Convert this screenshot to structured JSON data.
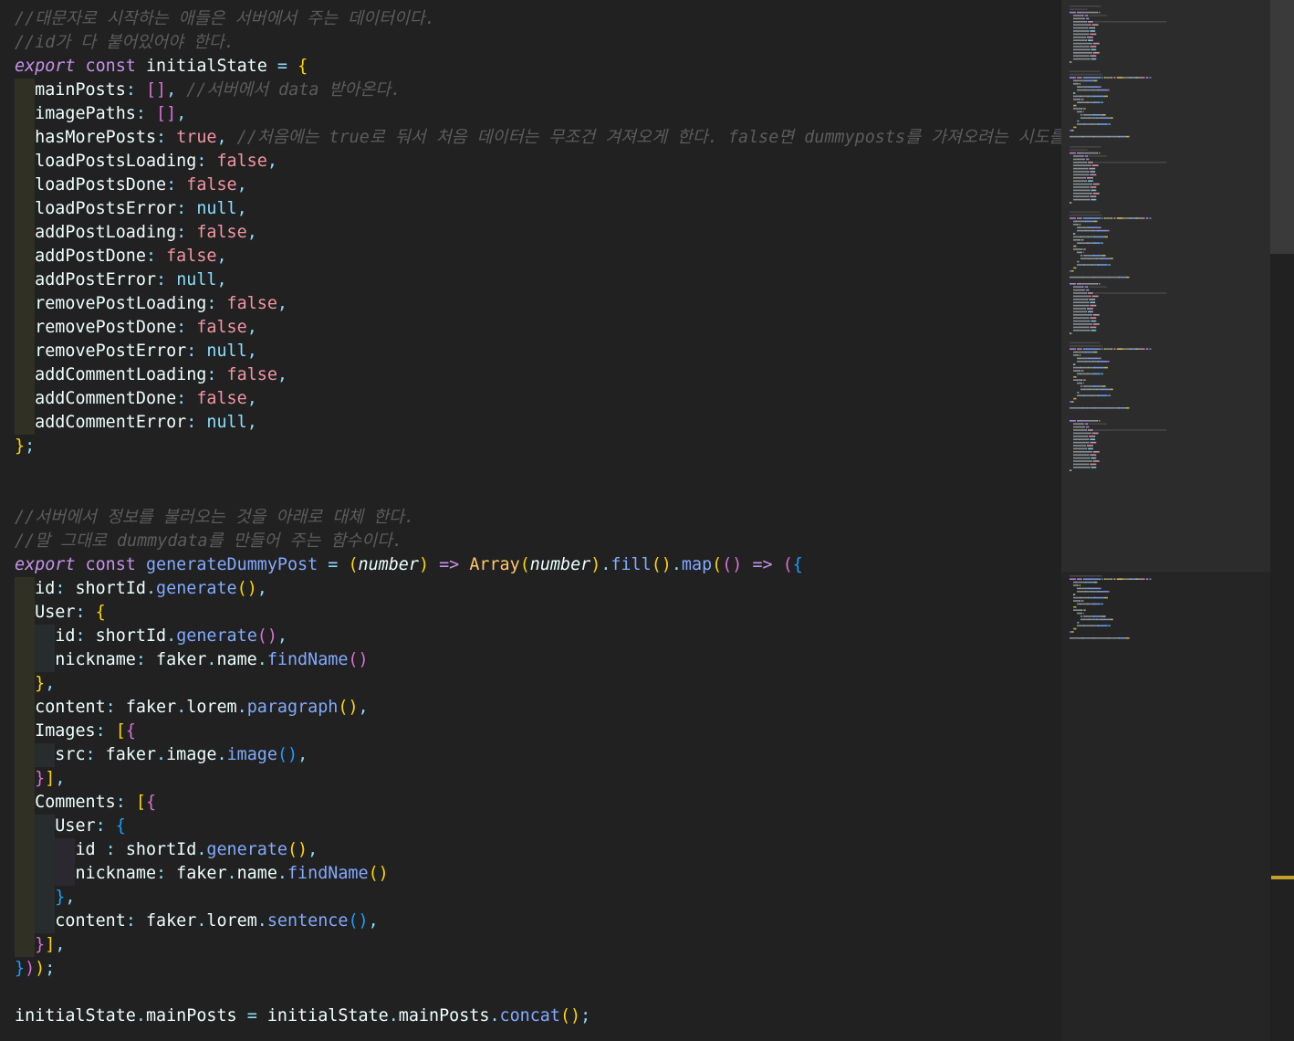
{
  "editor": {
    "language": "javascript",
    "lines": [
      {
        "indent": 0,
        "tokens": [
          [
            "cm",
            "//대문자로 시작하는 애들은 서버에서 주는 데이터이다."
          ]
        ]
      },
      {
        "indent": 0,
        "tokens": [
          [
            "cm",
            "//id가 다 붙어있어야 한다."
          ]
        ]
      },
      {
        "indent": 0,
        "tokens": [
          [
            "kw-i",
            "export"
          ],
          [
            "t",
            " "
          ],
          [
            "kw",
            "const"
          ],
          [
            "t",
            " initialState "
          ],
          [
            "op",
            "="
          ],
          [
            "t",
            " "
          ],
          [
            "p1",
            "{"
          ]
        ]
      },
      {
        "indent": 1,
        "tokens": [
          [
            "prop",
            "mainPosts"
          ],
          [
            "op",
            ":"
          ],
          [
            "t",
            " "
          ],
          [
            "p2",
            "[]"
          ],
          [
            "op",
            ","
          ],
          [
            "t",
            " "
          ],
          [
            "cm",
            "//서버에서 data 받아온다."
          ]
        ]
      },
      {
        "indent": 1,
        "tokens": [
          [
            "prop",
            "imagePaths"
          ],
          [
            "op",
            ":"
          ],
          [
            "t",
            " "
          ],
          [
            "p2",
            "[]"
          ],
          [
            "op",
            ","
          ]
        ]
      },
      {
        "indent": 1,
        "tokens": [
          [
            "prop",
            "hasMorePosts"
          ],
          [
            "op",
            ":"
          ],
          [
            "t",
            " "
          ],
          [
            "bool",
            "true"
          ],
          [
            "op",
            ","
          ],
          [
            "t",
            " "
          ],
          [
            "cm",
            "//처음에는 true로 둬서 처음 데이터는 무조건 겨져오게 한다. false면 dummyposts를 가져오려는 시도를 막는다"
          ]
        ]
      },
      {
        "indent": 1,
        "tokens": [
          [
            "prop",
            "loadPostsLoading"
          ],
          [
            "op",
            ":"
          ],
          [
            "t",
            " "
          ],
          [
            "bool",
            "false"
          ],
          [
            "op",
            ","
          ]
        ]
      },
      {
        "indent": 1,
        "tokens": [
          [
            "prop",
            "loadPostsDone"
          ],
          [
            "op",
            ":"
          ],
          [
            "t",
            " "
          ],
          [
            "bool",
            "false"
          ],
          [
            "op",
            ","
          ]
        ]
      },
      {
        "indent": 1,
        "tokens": [
          [
            "prop",
            "loadPostsError"
          ],
          [
            "op",
            ":"
          ],
          [
            "t",
            " "
          ],
          [
            "nul",
            "null"
          ],
          [
            "op",
            ","
          ]
        ]
      },
      {
        "indent": 1,
        "tokens": [
          [
            "prop",
            "addPostLoading"
          ],
          [
            "op",
            ":"
          ],
          [
            "t",
            " "
          ],
          [
            "bool",
            "false"
          ],
          [
            "op",
            ","
          ]
        ]
      },
      {
        "indent": 1,
        "tokens": [
          [
            "prop",
            "addPostDone"
          ],
          [
            "op",
            ":"
          ],
          [
            "t",
            " "
          ],
          [
            "bool",
            "false"
          ],
          [
            "op",
            ","
          ]
        ]
      },
      {
        "indent": 1,
        "tokens": [
          [
            "prop",
            "addPostError"
          ],
          [
            "op",
            ":"
          ],
          [
            "t",
            " "
          ],
          [
            "nul",
            "null"
          ],
          [
            "op",
            ","
          ]
        ]
      },
      {
        "indent": 1,
        "tokens": [
          [
            "prop",
            "removePostLoading"
          ],
          [
            "op",
            ":"
          ],
          [
            "t",
            " "
          ],
          [
            "bool",
            "false"
          ],
          [
            "op",
            ","
          ]
        ]
      },
      {
        "indent": 1,
        "tokens": [
          [
            "prop",
            "removePostDone"
          ],
          [
            "op",
            ":"
          ],
          [
            "t",
            " "
          ],
          [
            "bool",
            "false"
          ],
          [
            "op",
            ","
          ]
        ]
      },
      {
        "indent": 1,
        "tokens": [
          [
            "prop",
            "removePostError"
          ],
          [
            "op",
            ":"
          ],
          [
            "t",
            " "
          ],
          [
            "nul",
            "null"
          ],
          [
            "op",
            ","
          ]
        ]
      },
      {
        "indent": 1,
        "tokens": [
          [
            "prop",
            "addCommentLoading"
          ],
          [
            "op",
            ":"
          ],
          [
            "t",
            " "
          ],
          [
            "bool",
            "false"
          ],
          [
            "op",
            ","
          ]
        ]
      },
      {
        "indent": 1,
        "tokens": [
          [
            "prop",
            "addCommentDone"
          ],
          [
            "op",
            ":"
          ],
          [
            "t",
            " "
          ],
          [
            "bool",
            "false"
          ],
          [
            "op",
            ","
          ]
        ]
      },
      {
        "indent": 1,
        "tokens": [
          [
            "prop",
            "addCommentError"
          ],
          [
            "op",
            ":"
          ],
          [
            "t",
            " "
          ],
          [
            "nul",
            "null"
          ],
          [
            "op",
            ","
          ]
        ]
      },
      {
        "indent": 0,
        "tokens": [
          [
            "p1",
            "}"
          ],
          [
            "op",
            ";"
          ]
        ]
      },
      {
        "indent": 0,
        "tokens": []
      },
      {
        "indent": 0,
        "tokens": []
      },
      {
        "indent": 0,
        "tokens": [
          [
            "cm",
            "//서버에서 정보를 불러오는 것을 아래로 대체 한다."
          ]
        ]
      },
      {
        "indent": 0,
        "tokens": [
          [
            "cm",
            "//말 그대로 dummydata를 만들어 주는 함수이다."
          ]
        ]
      },
      {
        "indent": 0,
        "tokens": [
          [
            "kw-i",
            "export"
          ],
          [
            "t",
            " "
          ],
          [
            "kw",
            "const"
          ],
          [
            "t",
            " "
          ],
          [
            "fn",
            "generateDummyPost"
          ],
          [
            "t",
            " "
          ],
          [
            "op",
            "="
          ],
          [
            "t",
            " "
          ],
          [
            "p1",
            "("
          ],
          [
            "param",
            "number"
          ],
          [
            "p1",
            ")"
          ],
          [
            "t",
            " "
          ],
          [
            "kw",
            "=>"
          ],
          [
            "t",
            " "
          ],
          [
            "cls",
            "Array"
          ],
          [
            "p1",
            "("
          ],
          [
            "param",
            "number"
          ],
          [
            "p1",
            ")"
          ],
          [
            "op",
            "."
          ],
          [
            "fn",
            "fill"
          ],
          [
            "p1",
            "()"
          ],
          [
            "op",
            "."
          ],
          [
            "fn",
            "map"
          ],
          [
            "p1",
            "("
          ],
          [
            "p2",
            "()"
          ],
          [
            "t",
            " "
          ],
          [
            "kw",
            "=>"
          ],
          [
            "t",
            " "
          ],
          [
            "p2",
            "("
          ],
          [
            "p3",
            "{"
          ]
        ]
      },
      {
        "indent": 1,
        "tokens": [
          [
            "prop",
            "id"
          ],
          [
            "op",
            ":"
          ],
          [
            "t",
            " shortId"
          ],
          [
            "op",
            "."
          ],
          [
            "fn",
            "generate"
          ],
          [
            "p1",
            "()"
          ],
          [
            "op",
            ","
          ]
        ]
      },
      {
        "indent": 1,
        "tokens": [
          [
            "prop",
            "User"
          ],
          [
            "op",
            ":"
          ],
          [
            "t",
            " "
          ],
          [
            "p1",
            "{"
          ]
        ]
      },
      {
        "indent": 2,
        "tokens": [
          [
            "prop",
            "id"
          ],
          [
            "op",
            ":"
          ],
          [
            "t",
            " shortId"
          ],
          [
            "op",
            "."
          ],
          [
            "fn",
            "generate"
          ],
          [
            "p2",
            "()"
          ],
          [
            "op",
            ","
          ]
        ]
      },
      {
        "indent": 2,
        "tokens": [
          [
            "prop",
            "nickname"
          ],
          [
            "op",
            ":"
          ],
          [
            "t",
            " faker"
          ],
          [
            "op",
            "."
          ],
          [
            "t",
            "name"
          ],
          [
            "op",
            "."
          ],
          [
            "fn",
            "findName"
          ],
          [
            "p2",
            "()"
          ]
        ]
      },
      {
        "indent": 1,
        "tokens": [
          [
            "p1",
            "}"
          ],
          [
            "op",
            ","
          ]
        ]
      },
      {
        "indent": 1,
        "tokens": [
          [
            "prop",
            "content"
          ],
          [
            "op",
            ":"
          ],
          [
            "t",
            " faker"
          ],
          [
            "op",
            "."
          ],
          [
            "t",
            "lorem"
          ],
          [
            "op",
            "."
          ],
          [
            "fn",
            "paragraph"
          ],
          [
            "p1",
            "()"
          ],
          [
            "op",
            ","
          ]
        ]
      },
      {
        "indent": 1,
        "tokens": [
          [
            "prop",
            "Images"
          ],
          [
            "op",
            ":"
          ],
          [
            "t",
            " "
          ],
          [
            "p1",
            "["
          ],
          [
            "p2",
            "{"
          ]
        ]
      },
      {
        "indent": 2,
        "tokens": [
          [
            "prop",
            "src"
          ],
          [
            "op",
            ":"
          ],
          [
            "t",
            " faker"
          ],
          [
            "op",
            "."
          ],
          [
            "t",
            "image"
          ],
          [
            "op",
            "."
          ],
          [
            "fn",
            "image"
          ],
          [
            "p3",
            "()"
          ],
          [
            "op",
            ","
          ]
        ]
      },
      {
        "indent": 1,
        "tokens": [
          [
            "p2",
            "}"
          ],
          [
            "p1",
            "]"
          ],
          [
            "op",
            ","
          ]
        ]
      },
      {
        "indent": 1,
        "tokens": [
          [
            "prop",
            "Comments"
          ],
          [
            "op",
            ":"
          ],
          [
            "t",
            " "
          ],
          [
            "p1",
            "["
          ],
          [
            "p2",
            "{"
          ]
        ]
      },
      {
        "indent": 2,
        "tokens": [
          [
            "prop",
            "User"
          ],
          [
            "op",
            ":"
          ],
          [
            "t",
            " "
          ],
          [
            "p3",
            "{"
          ]
        ]
      },
      {
        "indent": 3,
        "tokens": [
          [
            "prop",
            "id"
          ],
          [
            "t",
            " "
          ],
          [
            "op",
            ":"
          ],
          [
            "t",
            " shortId"
          ],
          [
            "op",
            "."
          ],
          [
            "fn",
            "generate"
          ],
          [
            "p1",
            "()"
          ],
          [
            "op",
            ","
          ]
        ]
      },
      {
        "indent": 3,
        "tokens": [
          [
            "prop",
            "nickname"
          ],
          [
            "op",
            ":"
          ],
          [
            "t",
            " faker"
          ],
          [
            "op",
            "."
          ],
          [
            "t",
            "name"
          ],
          [
            "op",
            "."
          ],
          [
            "fn",
            "findName"
          ],
          [
            "p1",
            "()"
          ]
        ]
      },
      {
        "indent": 2,
        "tokens": [
          [
            "p3",
            "}"
          ],
          [
            "op",
            ","
          ]
        ]
      },
      {
        "indent": 2,
        "tokens": [
          [
            "prop",
            "content"
          ],
          [
            "op",
            ":"
          ],
          [
            "t",
            " faker"
          ],
          [
            "op",
            "."
          ],
          [
            "t",
            "lorem"
          ],
          [
            "op",
            "."
          ],
          [
            "fn",
            "sentence"
          ],
          [
            "p3",
            "()"
          ],
          [
            "op",
            ","
          ]
        ]
      },
      {
        "indent": 1,
        "tokens": [
          [
            "p2",
            "}"
          ],
          [
            "p1",
            "]"
          ],
          [
            "op",
            ","
          ]
        ]
      },
      {
        "indent": 0,
        "tokens": [
          [
            "p3",
            "}"
          ],
          [
            "p2",
            ")"
          ],
          [
            "p1",
            ")"
          ],
          [
            "op",
            ";"
          ]
        ]
      },
      {
        "indent": 0,
        "tokens": []
      },
      {
        "indent": 0,
        "tokens": [
          [
            "t",
            "initialState"
          ],
          [
            "op",
            "."
          ],
          [
            "t",
            "mainPosts "
          ],
          [
            "op",
            "="
          ],
          [
            "t",
            " initialState"
          ],
          [
            "op",
            "."
          ],
          [
            "t",
            "mainPosts"
          ],
          [
            "op",
            "."
          ],
          [
            "fn",
            "concat"
          ],
          [
            "p1",
            "()"
          ],
          [
            "op",
            ";"
          ]
        ]
      }
    ]
  },
  "minimap": {
    "visible": true
  },
  "colors": {
    "background": "#212121",
    "comment": "#5c5c5c",
    "keyword": "#c792ea",
    "function": "#82aaff",
    "boolean": "#ff9cac",
    "null": "#89ddff",
    "bracket1": "#ffd700",
    "bracket2": "#da70d6",
    "bracket3": "#179fff",
    "scroll_marker": "#c2a12a"
  }
}
